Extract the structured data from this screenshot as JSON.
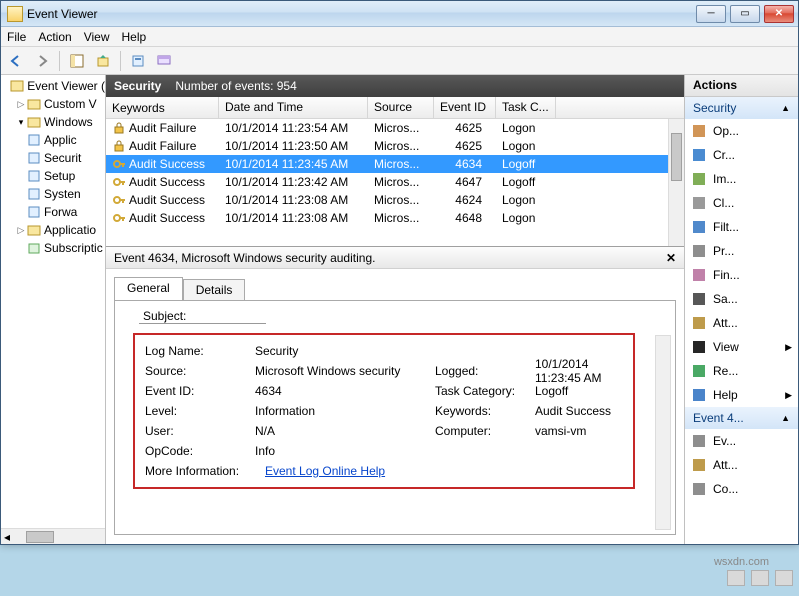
{
  "title": "Event Viewer",
  "menu": {
    "file": "File",
    "action": "Action",
    "view": "View",
    "help": "Help"
  },
  "tree": {
    "root": "Event Viewer (",
    "custom": "Custom V",
    "windows": "Windows",
    "app": "Applic",
    "sec": "Securit",
    "setup": "Setup",
    "system": "Systen",
    "forw": "Forwa",
    "appserv": "Applicatio",
    "subs": "Subscriptic"
  },
  "logheader": {
    "name": "Security",
    "count_label": "Number of events: 954"
  },
  "columns": {
    "c1": "Keywords",
    "c2": "Date and Time",
    "c3": "Source",
    "c4": "Event ID",
    "c5": "Task C..."
  },
  "rows": [
    {
      "kw": "Audit Failure",
      "dt": "10/1/2014 11:23:54 AM",
      "src": "Micros...",
      "id": "4625",
      "tc": "Logon",
      "type": "lock"
    },
    {
      "kw": "Audit Failure",
      "dt": "10/1/2014 11:23:50 AM",
      "src": "Micros...",
      "id": "4625",
      "tc": "Logon",
      "type": "lock"
    },
    {
      "kw": "Audit Success",
      "dt": "10/1/2014 11:23:45 AM",
      "src": "Micros...",
      "id": "4634",
      "tc": "Logoff",
      "type": "key",
      "sel": true
    },
    {
      "kw": "Audit Success",
      "dt": "10/1/2014 11:23:42 AM",
      "src": "Micros...",
      "id": "4647",
      "tc": "Logoff",
      "type": "key"
    },
    {
      "kw": "Audit Success",
      "dt": "10/1/2014 11:23:08 AM",
      "src": "Micros...",
      "id": "4624",
      "tc": "Logon",
      "type": "key"
    },
    {
      "kw": "Audit Success",
      "dt": "10/1/2014 11:23:08 AM",
      "src": "Micros...",
      "id": "4648",
      "tc": "Logon",
      "type": "key"
    }
  ],
  "detail": {
    "header": "Event 4634, Microsoft Windows security auditing.",
    "tab_general": "General",
    "tab_details": "Details",
    "subject": "Subject:",
    "logname_k": "Log Name:",
    "logname_v": "Security",
    "source_k": "Source:",
    "source_v": "Microsoft Windows security",
    "logged_k": "Logged:",
    "logged_v": "10/1/2014 11:23:45 AM",
    "eventid_k": "Event ID:",
    "eventid_v": "4634",
    "taskcat_k": "Task Category:",
    "taskcat_v": "Logoff",
    "level_k": "Level:",
    "level_v": "Information",
    "keywords_k": "Keywords:",
    "keywords_v": "Audit Success",
    "user_k": "User:",
    "user_v": "N/A",
    "computer_k": "Computer:",
    "computer_v": "vamsi-vm",
    "opcode_k": "OpCode:",
    "opcode_v": "Info",
    "moreinfo_k": "More Information:",
    "moreinfo_v": "Event Log Online Help"
  },
  "actions": {
    "title": "Actions",
    "group1": "Security",
    "group2": "Event 4...",
    "items1": [
      "Op...",
      "Cr...",
      "Im...",
      "Cl...",
      "Filt...",
      "Pr...",
      "Fin...",
      "Sa...",
      "Att...",
      "View",
      "Re...",
      "Help"
    ],
    "items2": [
      "Ev...",
      "Att...",
      "Co..."
    ]
  },
  "watermark": "wsxdn.com"
}
